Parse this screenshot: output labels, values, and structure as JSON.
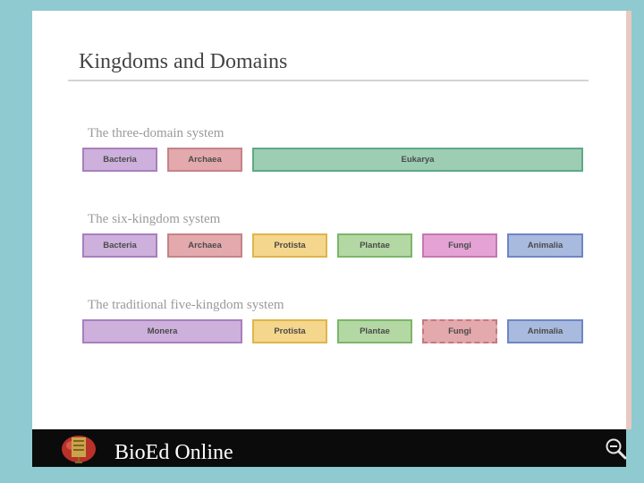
{
  "slide": {
    "title": "Kingdoms and Domains",
    "sections": [
      {
        "label": "The three-domain system",
        "boxes": [
          {
            "label": "Bacteria",
            "color": "#cdb0dc"
          },
          {
            "label": "Archaea",
            "color": "#e3a9ad"
          },
          {
            "label": "Eukarya",
            "color": "#9dcdb3"
          }
        ]
      },
      {
        "label": "The six-kingdom system",
        "boxes": [
          {
            "label": "Bacteria",
            "color": "#cdb0dc"
          },
          {
            "label": "Archaea",
            "color": "#e3a9ad"
          },
          {
            "label": "Protista",
            "color": "#f4d68c"
          },
          {
            "label": "Plantae",
            "color": "#b4d8a4"
          },
          {
            "label": "Fungi",
            "color": "#e4a3d4"
          },
          {
            "label": "Animalia",
            "color": "#a9badf"
          }
        ]
      },
      {
        "label": "The traditional five-kingdom system",
        "boxes": [
          {
            "label": "Monera",
            "color": "#cdb0dc"
          },
          {
            "label": "Protista",
            "color": "#f4d68c"
          },
          {
            "label": "Plantae",
            "color": "#b4d8a4"
          },
          {
            "label": "Fungi",
            "color": "#e3a9ad"
          },
          {
            "label": "Animalia",
            "color": "#a9badf"
          }
        ]
      }
    ]
  },
  "footer": {
    "brand": "BioEd Online",
    "logo_icon": "bioed-logo-icon",
    "zoom_icon": "zoom-out-icon"
  },
  "colors": {
    "background": "#8ecad0",
    "footer": "#0b0b0b"
  }
}
